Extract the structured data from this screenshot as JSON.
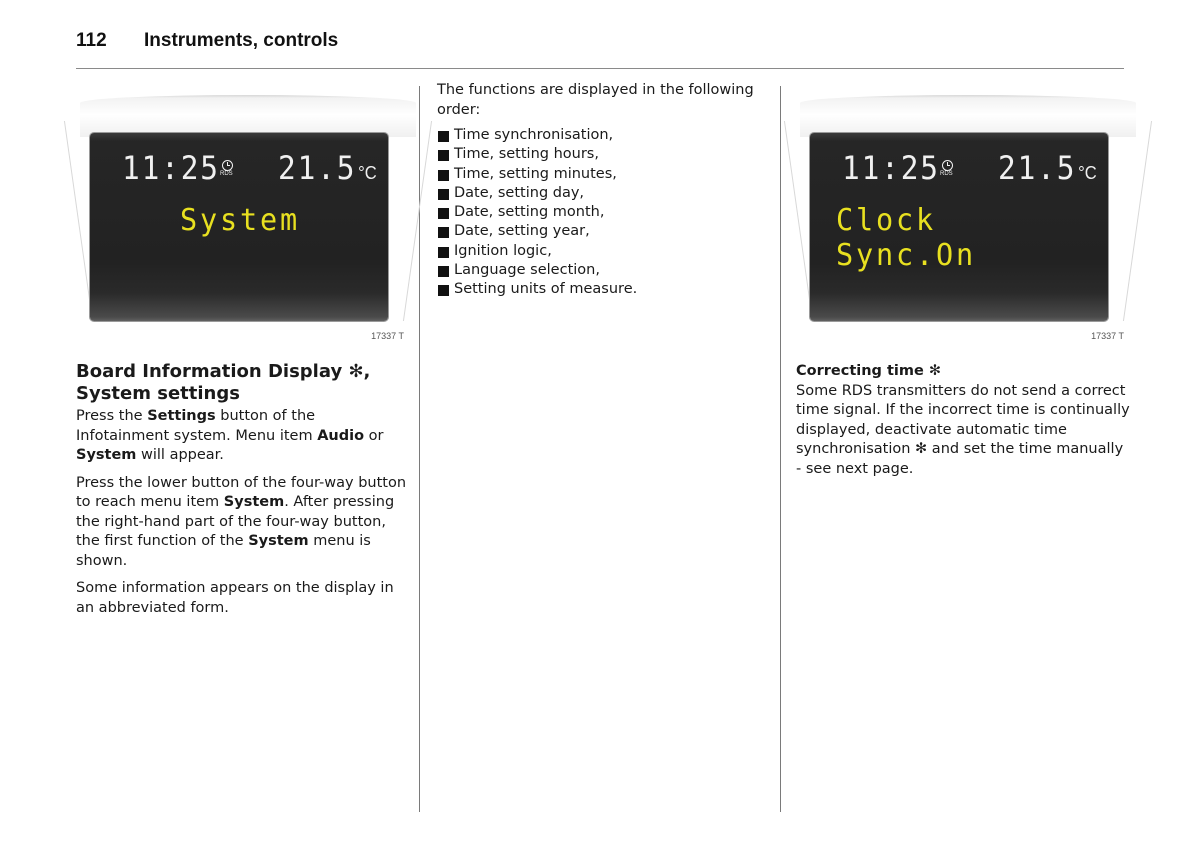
{
  "header": {
    "page_number": "112",
    "section_title": "Instruments, controls"
  },
  "figures": [
    {
      "time": "11:25",
      "rds_label": "RDS",
      "temperature": "21.5",
      "temperature_unit": "°C",
      "menu_text": "System",
      "figure_code": "17337 T"
    },
    {
      "time": "11:25",
      "rds_label": "RDS",
      "temperature": "21.5",
      "temperature_unit": "°C",
      "menu_text": "Clock Sync.On",
      "figure_code": "17337 T"
    }
  ],
  "column1": {
    "heading_line1": "Board Information Display ✻,",
    "heading_line2": "System settings",
    "para1": {
      "t1": "Press the ",
      "b1": "Settings",
      "t2": " button of the Infotainment system. Menu item ",
      "b2": "Audio",
      "t3": " or ",
      "b3": "System",
      "t4": " will appear."
    },
    "para2": {
      "t1": "Press the lower button of the four-way button to reach menu item ",
      "b1": "System",
      "t2": ". After pressing the right-hand part of the four-way button, the first function of the ",
      "b2": "System",
      "t3": " menu is shown."
    },
    "para3": "Some information appears on the display in an abbreviated form."
  },
  "column2": {
    "intro": "The functions are displayed in the following order:",
    "functions": [
      "Time synchronisation,",
      "Time, setting hours,",
      "Time, setting minutes,",
      "Date, setting day,",
      "Date, setting month,",
      "Date, setting year,",
      "Ignition logic,",
      "Language selection,",
      "Setting units of measure."
    ]
  },
  "column3": {
    "subheading": "Correcting time ✻",
    "body": "Some RDS transmitters do not send a correct time signal. If the incorrect time is continually displayed, deactivate automatic time synchronisation ✻ and set the time manually - see next page."
  }
}
